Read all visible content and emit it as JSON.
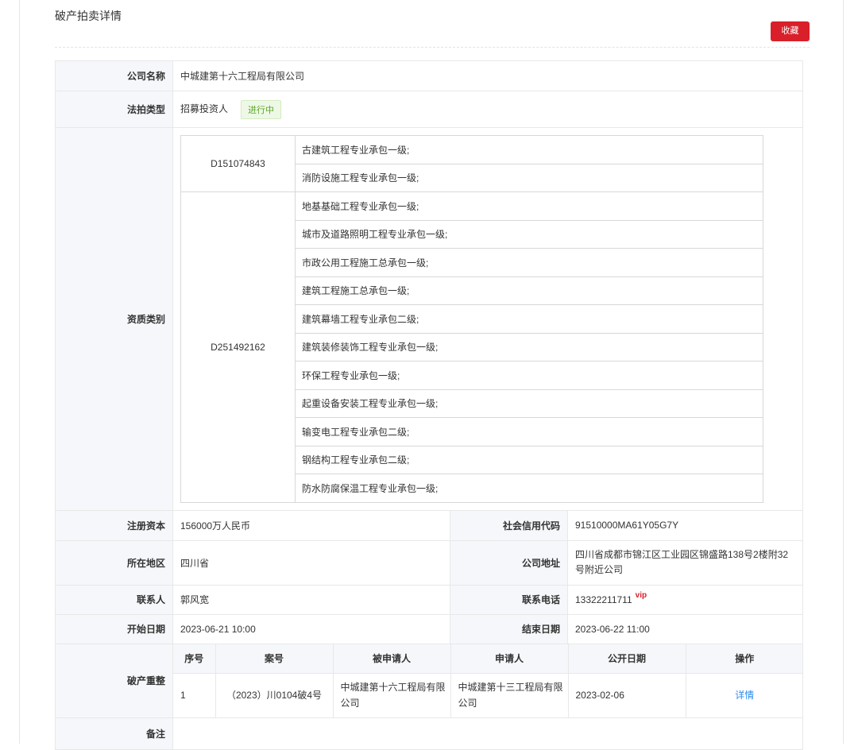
{
  "page": {
    "title": "破产拍卖详情",
    "favorite_label": "收藏"
  },
  "info": {
    "company_label": "公司名称",
    "company_value": "中城建第十六工程局有限公司",
    "auction_type_label": "法拍类型",
    "auction_type_value": "招募投资人",
    "status_tag": "进行中",
    "qualification_label": "资质类别",
    "qualifications": [
      {
        "code": "D151074843",
        "items": [
          "古建筑工程专业承包一级;",
          "消防设施工程专业承包一级;"
        ]
      },
      {
        "code": "D251492162",
        "items": [
          "地基基础工程专业承包一级;",
          "城市及道路照明工程专业承包一级;",
          "市政公用工程施工总承包一级;",
          "建筑工程施工总承包一级;",
          "建筑幕墙工程专业承包二级;",
          "建筑装修装饰工程专业承包一级;",
          "环保工程专业承包一级;",
          "起重设备安装工程专业承包一级;",
          "输变电工程专业承包二级;",
          "钢结构工程专业承包二级;",
          "防水防腐保温工程专业承包一级;"
        ]
      }
    ],
    "capital_label": "注册资本",
    "capital_value": "156000万人民币",
    "credit_label": "社会信用代码",
    "credit_value": "91510000MA61Y05G7Y",
    "region_label": "所在地区",
    "region_value": "四川省",
    "address_label": "公司地址",
    "address_value": "四川省成都市锦江区工业园区锦盛路138号2楼附32号附近公司",
    "contact_label": "联系人",
    "contact_value": "郭风宽",
    "phone_label": "联系电话",
    "phone_value": "13322211711",
    "vip_badge": "vip",
    "start_label": "开始日期",
    "start_value": "2023-06-21 10:00",
    "end_label": "结束日期",
    "end_value": "2023-06-22 11:00",
    "restructure_label": "破产重整",
    "remark_label": "备注",
    "remark_value": ""
  },
  "cases": {
    "headers": [
      "序号",
      "案号",
      "被申请人",
      "申请人",
      "公开日期",
      "操作"
    ],
    "rows": [
      {
        "index": "1",
        "case_no": "（2023）川0104破4号",
        "respondent": "中城建第十六工程局有限公司",
        "applicant": "中城建第十三工程局有限公司",
        "date": "2023-02-06",
        "action": "详情"
      }
    ]
  }
}
